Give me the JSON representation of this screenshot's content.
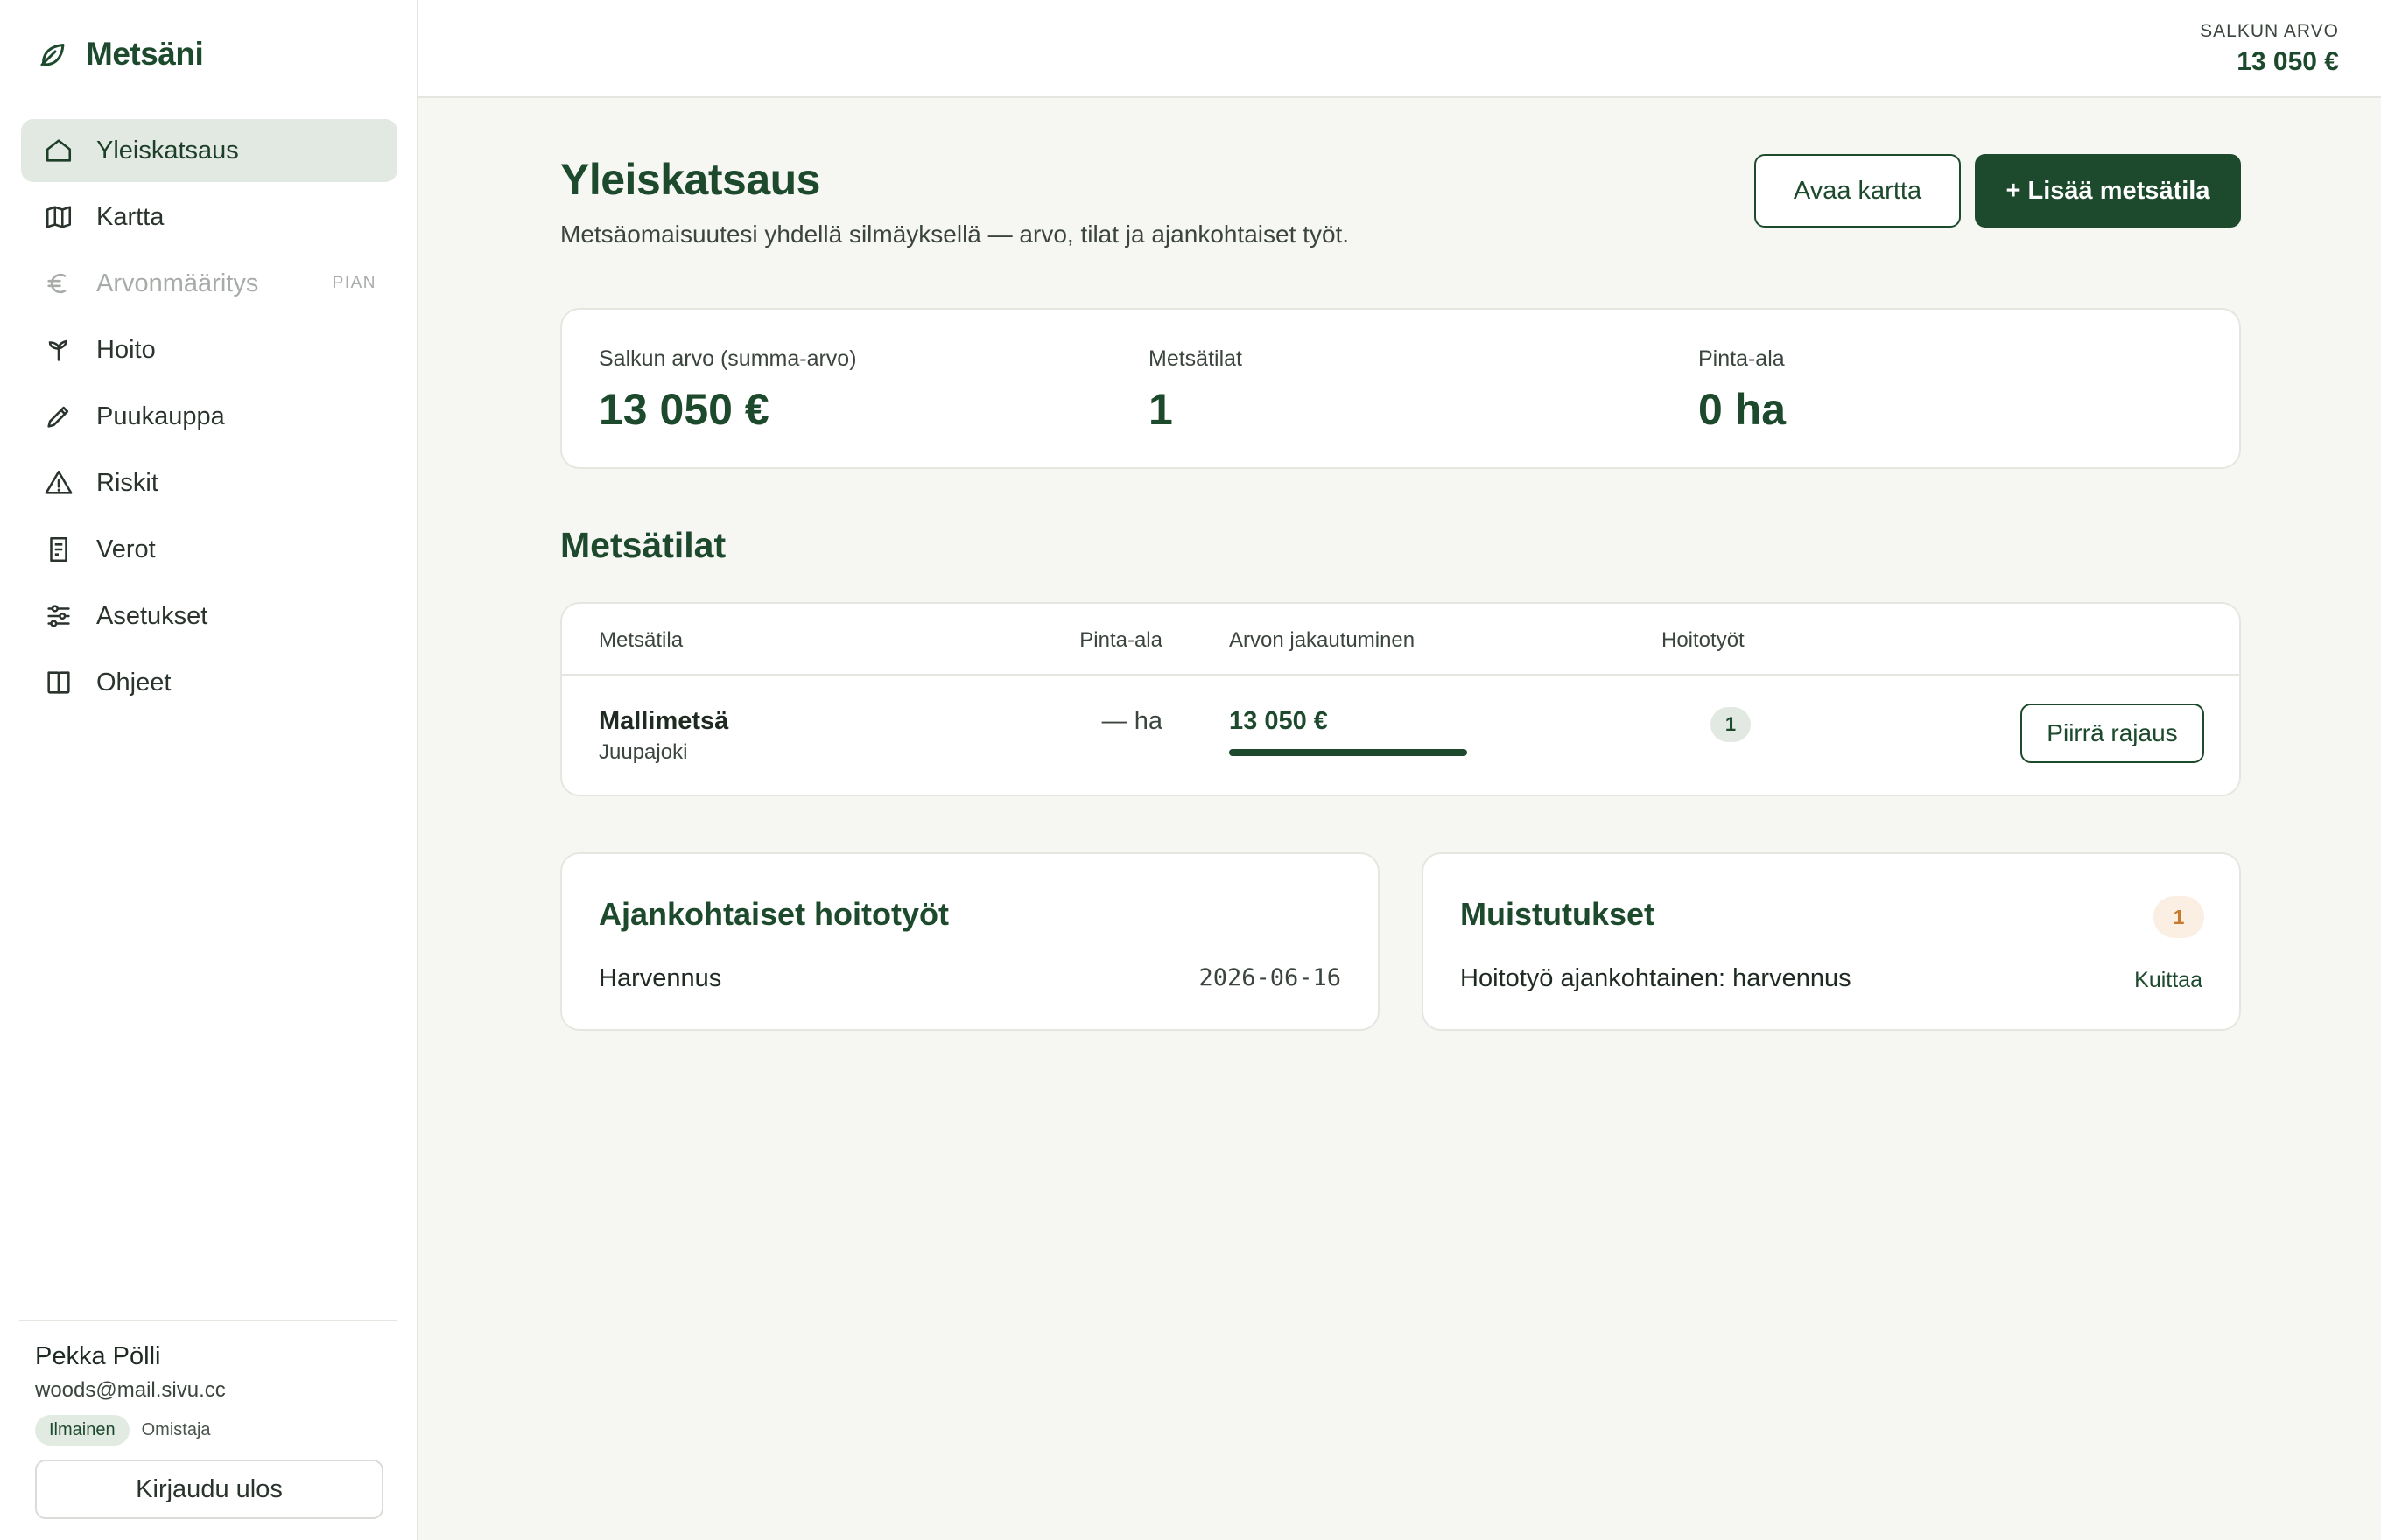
{
  "app": {
    "name": "Metsäni"
  },
  "nav": {
    "items": [
      {
        "label": "Yleiskatsaus",
        "icon": "home-icon"
      },
      {
        "label": "Kartta",
        "icon": "map-icon"
      },
      {
        "label": "Arvonmääritys",
        "icon": "euro-icon",
        "badge": "PIAN"
      },
      {
        "label": "Hoito",
        "icon": "sprout-icon"
      },
      {
        "label": "Puukauppa",
        "icon": "pen-icon"
      },
      {
        "label": "Riskit",
        "icon": "warning-icon"
      },
      {
        "label": "Verot",
        "icon": "receipt-icon"
      },
      {
        "label": "Asetukset",
        "icon": "sliders-icon"
      },
      {
        "label": "Ohjeet",
        "icon": "book-icon"
      }
    ]
  },
  "user": {
    "name": "Pekka Pölli",
    "email": "woods@mail.sivu.cc",
    "plan": "Ilmainen",
    "role": "Omistaja",
    "logout_label": "Kirjaudu ulos"
  },
  "topbar": {
    "value_label": "SALKUN ARVO",
    "value": "13 050 €"
  },
  "header": {
    "title": "Yleiskatsaus",
    "subtitle": "Metsäomaisuutesi yhdellä silmäyksellä — arvo, tilat ja ajankohtaiset työt.",
    "open_map_label": "Avaa kartta",
    "add_estate_label": "+ Lisää metsätila"
  },
  "stats": {
    "portfolio_label": "Salkun arvo (summa-arvo)",
    "portfolio_value": "13 050 €",
    "estates_label": "Metsätilat",
    "estates_value": "1",
    "area_label": "Pinta-ala",
    "area_value": "0 ha"
  },
  "estates": {
    "title": "Metsätilat",
    "columns": {
      "name": "Metsätila",
      "area": "Pinta-ala",
      "value": "Arvon jakautuminen",
      "tasks": "Hoitotyöt"
    },
    "rows": [
      {
        "name": "Mallimetsä",
        "location": "Juupajoki",
        "area": "— ha",
        "value": "13 050 €",
        "value_share": 1.0,
        "tasks": "1",
        "action_label": "Piirrä rajaus"
      }
    ]
  },
  "tasks_panel": {
    "title": "Ajankohtaiset hoitotyöt",
    "item": "Harvennus",
    "date": "2026-06-16"
  },
  "reminders_panel": {
    "title": "Muistutukset",
    "count": "1",
    "item": "Hoitotyö ajankohtainen: harvennus",
    "ack_label": "Kuittaa"
  },
  "colors": {
    "brand": "#1d4a2c",
    "accent_bg": "#e2e8e2",
    "warning": "#c77a2c"
  }
}
